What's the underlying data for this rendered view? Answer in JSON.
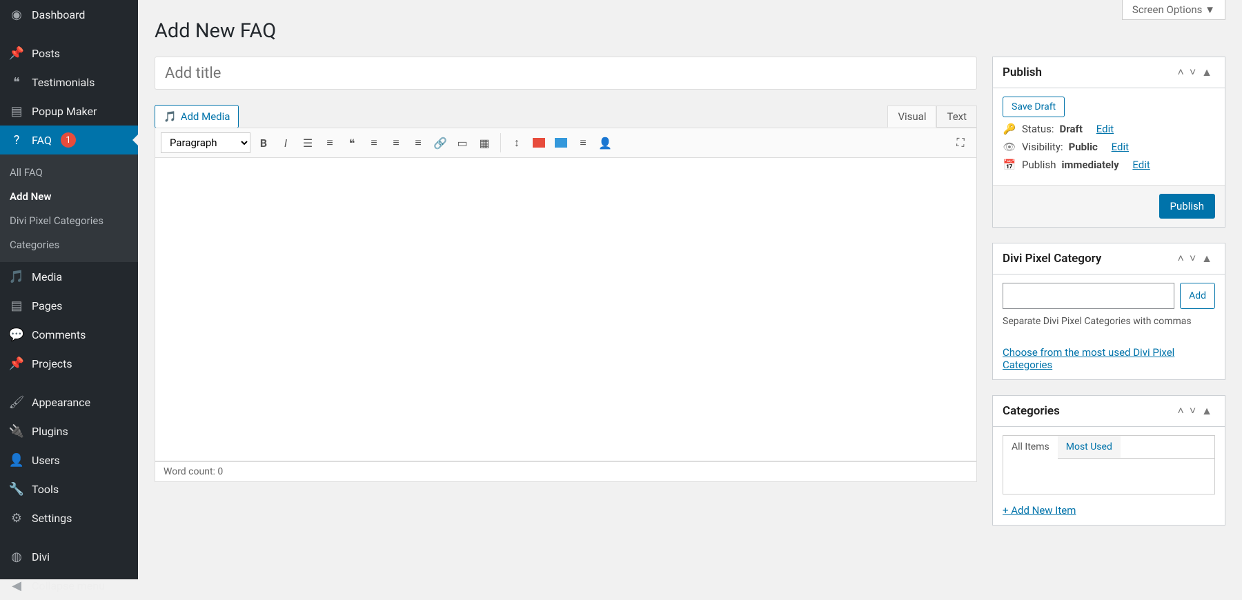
{
  "sidebar": {
    "items": [
      {
        "icon": "dashboard",
        "label": "Dashboard"
      },
      {
        "icon": "pin",
        "label": "Posts"
      },
      {
        "icon": "quote",
        "label": "Testimonials"
      },
      {
        "icon": "pages",
        "label": "Popup Maker"
      },
      {
        "icon": "help",
        "label": "FAQ",
        "badge": "1",
        "active": true
      },
      {
        "icon": "media",
        "label": "Media"
      },
      {
        "icon": "pages",
        "label": "Pages"
      },
      {
        "icon": "comment",
        "label": "Comments"
      },
      {
        "icon": "pin",
        "label": "Projects"
      },
      {
        "icon": "brush",
        "label": "Appearance"
      },
      {
        "icon": "plugin",
        "label": "Plugins"
      },
      {
        "icon": "user",
        "label": "Users"
      },
      {
        "icon": "wrench",
        "label": "Tools"
      },
      {
        "icon": "settings",
        "label": "Settings"
      },
      {
        "icon": "divi",
        "label": "Divi"
      },
      {
        "icon": "collapse",
        "label": "Collapse menu"
      }
    ],
    "sub": [
      {
        "label": "All FAQ"
      },
      {
        "label": "Add New",
        "current": true
      },
      {
        "label": "Divi Pixel Categories"
      },
      {
        "label": "Categories"
      }
    ]
  },
  "screen_options": "Screen Options",
  "page_title": "Add New FAQ",
  "title_placeholder": "Add title",
  "add_media": "Add Media",
  "editor_tabs": {
    "visual": "Visual",
    "text": "Text"
  },
  "format_default": "Paragraph",
  "word_count_label": "Word count: ",
  "word_count": "0",
  "publish": {
    "title": "Publish",
    "save_draft": "Save Draft",
    "status_lbl": "Status: ",
    "status_val": "Draft",
    "status_edit": "Edit",
    "vis_lbl": "Visibility: ",
    "vis_val": "Public",
    "vis_edit": "Edit",
    "pub_lbl": "Publish ",
    "pub_val": "immediately",
    "pub_edit": "Edit",
    "publish_btn": "Publish"
  },
  "dpcat": {
    "title": "Divi Pixel Category",
    "add": "Add",
    "hint": "Separate Divi Pixel Categories with commas",
    "link": "Choose from the most used Divi Pixel Categories"
  },
  "cats": {
    "title": "Categories",
    "tab_all": "All Items",
    "tab_most": "Most Used",
    "add_new": "+ Add New Item"
  }
}
